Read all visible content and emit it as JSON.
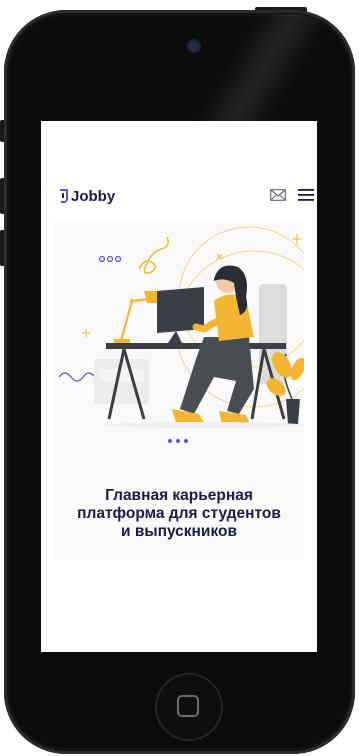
{
  "device": {
    "type": "phone-mockup"
  },
  "app": {
    "logo_text": "Jobby",
    "icons": {
      "mail": "mail-icon",
      "menu": "hamburger-menu-icon"
    }
  },
  "hero": {
    "headline_line1": "Главная карьерная",
    "headline_line2": "платформа для студентов",
    "headline_line3": "и выпускников",
    "illustration": "woman-working-at-computer-illustration"
  },
  "colors": {
    "brand_dark": "#1c1a4a",
    "accent_yellow": "#f2b632",
    "accent_purple": "#5b55c9",
    "hero_background": "#fafafa"
  }
}
